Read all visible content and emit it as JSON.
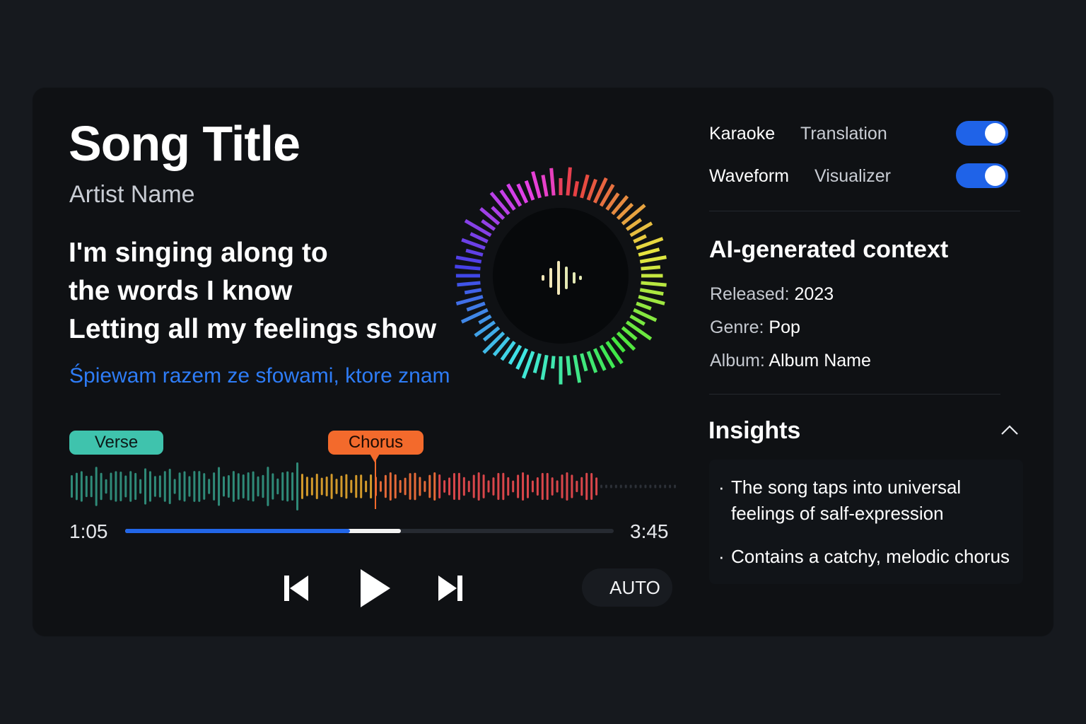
{
  "song": {
    "title": "Song Title",
    "artist": "Artist Name"
  },
  "lyrics": {
    "lines": [
      "I'm singing along to",
      "the words I know",
      "Letting all my feelings show"
    ],
    "translation": "Śpiewam razem ze sfowami, ktore znam"
  },
  "sections": {
    "verse": "Verse",
    "chorus": "Chorus"
  },
  "playback": {
    "current_time": "1:05",
    "total_time": "3:45",
    "progress": 0.46,
    "buffered": 0.565,
    "auto_label": "AUTO"
  },
  "toggles": [
    {
      "option_a": "Karaoke",
      "option_b": "Translation",
      "enabled": true
    },
    {
      "option_a": "Waveform",
      "option_b": "Visualizer",
      "enabled": true
    }
  ],
  "context": {
    "heading": "AI-generated context",
    "released_label": "Released:",
    "released_value": "2023",
    "genre_label": "Genre:",
    "genre_value": "Pop",
    "album_label": "Album:",
    "album_value": "Album Name"
  },
  "insights": {
    "heading": "Insights",
    "items": [
      "The song taps into universal feelings of salf-expression",
      "Contains a catchy, melodic chorus"
    ]
  },
  "colors": {
    "accent": "#2266e8",
    "verse": "#3fc3ad",
    "chorus": "#f36a2c",
    "translation": "#2e7cf6"
  },
  "icons": {
    "previous": "skip-previous-icon",
    "play": "play-icon",
    "next": "skip-next-icon",
    "collapse": "chevron-up-icon",
    "audio": "audio-wave-icon"
  }
}
